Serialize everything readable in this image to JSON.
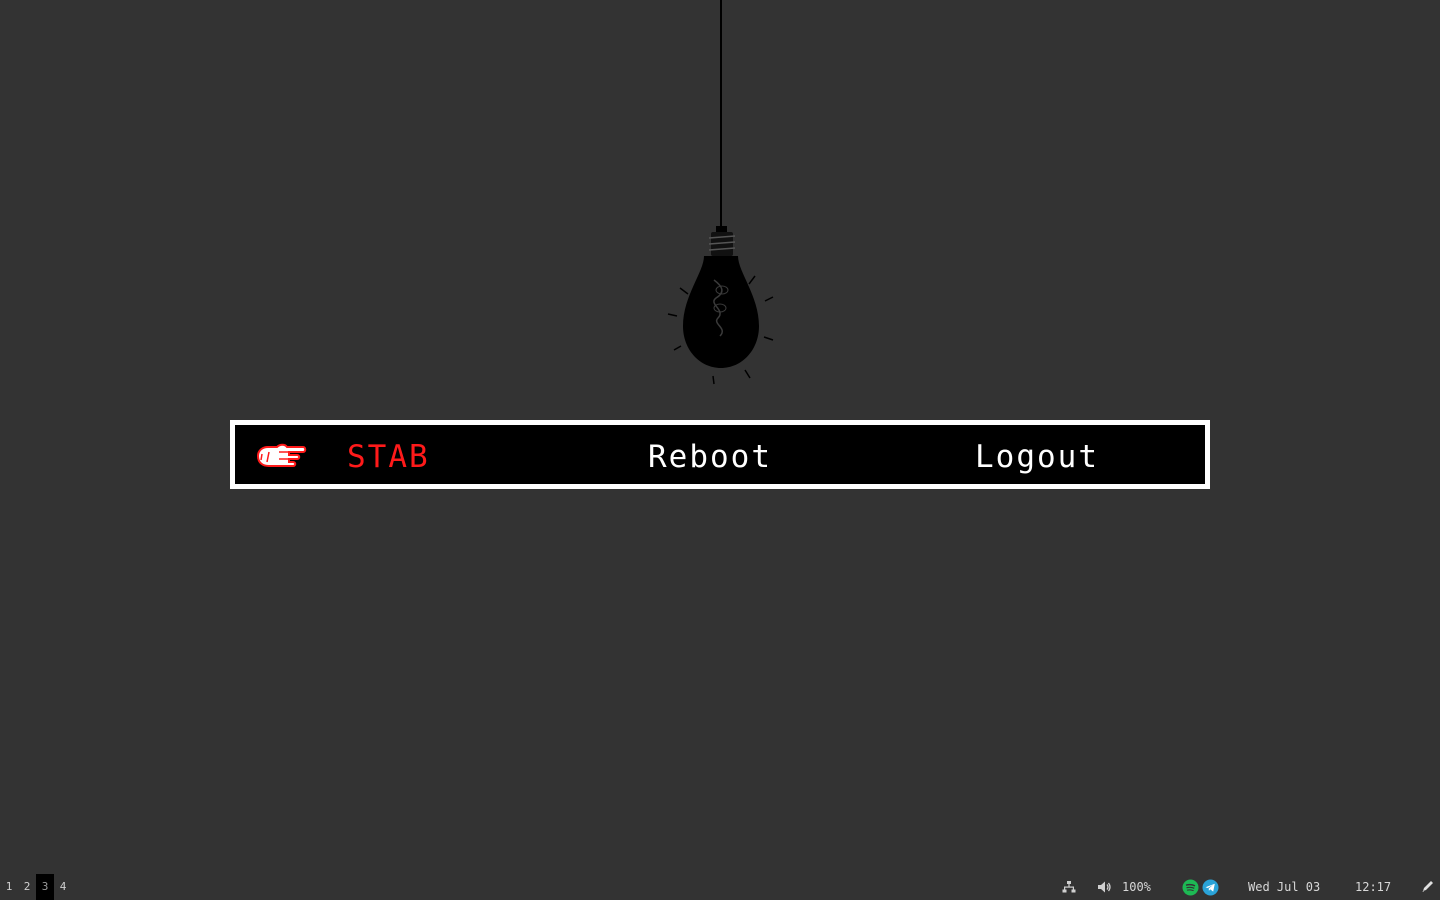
{
  "power_menu": {
    "items": [
      {
        "label": "STAB",
        "selected": true
      },
      {
        "label": "Reboot",
        "selected": false
      },
      {
        "label": "Logout",
        "selected": false
      }
    ],
    "selected_color": "#ff1a1a",
    "text_color": "#ffffff",
    "pointer_icon": "pointing-hand-icon"
  },
  "statusbar": {
    "workspaces": [
      "1",
      "2",
      "3",
      "4"
    ],
    "active_workspace": "3",
    "network_icon": "network-icon",
    "volume_icon": "speaker-icon",
    "volume": "100%",
    "tray": [
      "spotify-icon",
      "telegram-icon"
    ],
    "date": "Wed Jul 03",
    "time": "12:17",
    "right_icon": "pen-icon"
  },
  "colors": {
    "background": "#333333",
    "menu_bg": "#000000",
    "menu_border": "#ffffff",
    "spotify": "#1db954",
    "telegram": "#2aa3d8"
  }
}
